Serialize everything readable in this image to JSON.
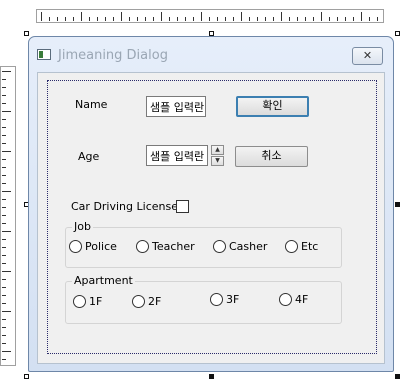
{
  "dialog": {
    "title": "Jimeaning Dialog",
    "close_glyph": "✕"
  },
  "form": {
    "name_label": "Name",
    "name_value": "샘플 입력란",
    "ok_label": "확인",
    "age_label": "Age",
    "age_value": "샘플 입력란",
    "spin_up": "▲",
    "spin_down": "▼",
    "cancel_label": "취소",
    "license_label": "Car Driving License"
  },
  "job": {
    "title": "Job",
    "options": [
      "Police",
      "Teacher",
      "Casher",
      "Etc"
    ]
  },
  "apartment": {
    "title": "Apartment",
    "options": [
      "1F",
      "2F",
      "3F",
      "4F"
    ]
  }
}
